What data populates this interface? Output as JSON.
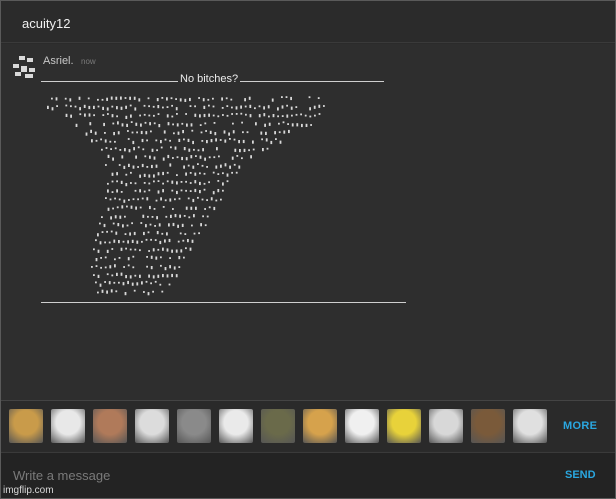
{
  "header": {
    "title": "acuity12"
  },
  "message": {
    "sender": "Asriel.",
    "timestamp": "now",
    "caption": "No bitches?"
  },
  "thumbnails": [
    {
      "icon": "cat-meme-icon",
      "color": "#c99b4a"
    },
    {
      "icon": "rage-face-icon",
      "color": "#e8e8e8"
    },
    {
      "icon": "pointing-person-icon",
      "color": "#b07a5a"
    },
    {
      "icon": "trollface-icon",
      "color": "#dcdcdc"
    },
    {
      "icon": "grumpy-cat-icon",
      "color": "#8a8a8a"
    },
    {
      "icon": "laughing-face-icon",
      "color": "#eaeaea"
    },
    {
      "icon": "angry-cat-icon",
      "color": "#6a6a4a"
    },
    {
      "icon": "doge-icon",
      "color": "#d6a24c"
    },
    {
      "icon": "derp-face-icon",
      "color": "#f0f0f0"
    },
    {
      "icon": "spongebob-icon",
      "color": "#e8d23a"
    },
    {
      "icon": "okay-face-icon",
      "color": "#d8d8d8"
    },
    {
      "icon": "toasting-man-icon",
      "color": "#7a5a3a"
    },
    {
      "icon": "disappointed-face-icon",
      "color": "#e0e0e0"
    }
  ],
  "controls": {
    "more_label": "MORE",
    "send_label": "SEND"
  },
  "composer": {
    "placeholder": "Write a message"
  },
  "watermark": "imgflip.com",
  "colors": {
    "accent": "#2aa7e0",
    "background": "#2b2b2b"
  }
}
